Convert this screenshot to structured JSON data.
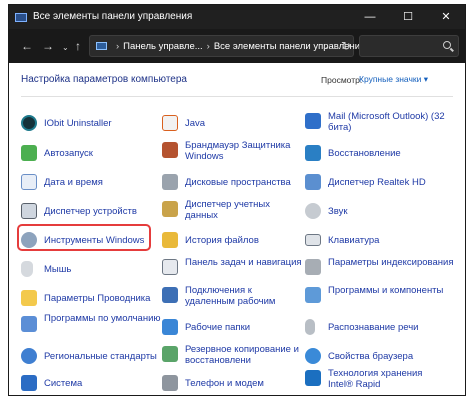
{
  "window": {
    "title": "Все элементы панели управления",
    "min_glyph": "—",
    "max_glyph": "☐",
    "close_glyph": "✕"
  },
  "nav": {
    "back_glyph": "←",
    "forward_glyph": "→",
    "history_glyph": "⌄",
    "up_glyph": "↑",
    "breadcrumb": [
      "Панель управле...",
      "Все элементы панели управления"
    ],
    "crumb_separator": "›",
    "dropdown_glyph": "⌄",
    "refresh_glyph": "↻",
    "search_placeholder": ""
  },
  "header": {
    "title": "Настройка параметров компьютера",
    "view_label": "Просмотр:",
    "view_value": "Крупные значки ▾"
  },
  "colors": {
    "link": "#1f3aa6",
    "header": "#1e3287",
    "highlight": "#e53c3c",
    "titlebar": "#202020"
  },
  "items": {
    "col1": [
      {
        "label": "IObit Uninstaller",
        "icon": "iobit-icon"
      },
      {
        "label": "Автозапуск",
        "icon": "autoplay-icon"
      },
      {
        "label": "Дата и время",
        "icon": "date-time-icon"
      },
      {
        "label": "Диспетчер устройств",
        "icon": "device-manager-icon"
      },
      {
        "label": "Инструменты Windows",
        "icon": "windows-tools-icon"
      },
      {
        "label": "Мышь",
        "icon": "mouse-icon"
      },
      {
        "label": "Параметры Проводника",
        "icon": "explorer-options-icon"
      },
      {
        "label": "Программы по умолчанию",
        "icon": "default-programs-icon"
      },
      {
        "label": "Региональные стандарты",
        "icon": "region-icon"
      },
      {
        "label": "Система",
        "icon": "system-icon"
      }
    ],
    "col2": [
      {
        "label": "Java",
        "icon": "java-icon"
      },
      {
        "label": "Брандмауэр Защитника Windows",
        "icon": "firewall-icon"
      },
      {
        "label": "Дисковые пространства",
        "icon": "storage-spaces-icon"
      },
      {
        "label": "Диспетчер учетных данных",
        "icon": "credential-manager-icon"
      },
      {
        "label": "История файлов",
        "icon": "file-history-icon"
      },
      {
        "label": "Панель задач и навигация",
        "icon": "taskbar-icon"
      },
      {
        "label": "Подключения к удаленным рабочим",
        "icon": "remote-desktop-icon"
      },
      {
        "label": "Рабочие папки",
        "icon": "work-folders-icon"
      },
      {
        "label": "Резервное копирование и восстановлени",
        "icon": "backup-icon"
      },
      {
        "label": "Телефон и модем",
        "icon": "phone-modem-icon"
      }
    ],
    "col3": [
      {
        "label": "Mail (Microsoft Outlook) (32 бита)",
        "icon": "mail-icon"
      },
      {
        "label": "Восстановление",
        "icon": "recovery-icon"
      },
      {
        "label": "Диспетчер Realtek HD",
        "icon": "realtek-icon"
      },
      {
        "label": "Звук",
        "icon": "sound-icon"
      },
      {
        "label": "Клавиатура",
        "icon": "keyboard-icon"
      },
      {
        "label": "Параметры индексирования",
        "icon": "indexing-icon"
      },
      {
        "label": "Программы и компоненты",
        "icon": "programs-features-icon"
      },
      {
        "label": "Распознавание речи",
        "icon": "speech-icon"
      },
      {
        "label": "Свойства браузера",
        "icon": "internet-options-icon"
      },
      {
        "label": "Технология хранения Intel® Rapid",
        "icon": "intel-rst-icon"
      }
    ]
  }
}
